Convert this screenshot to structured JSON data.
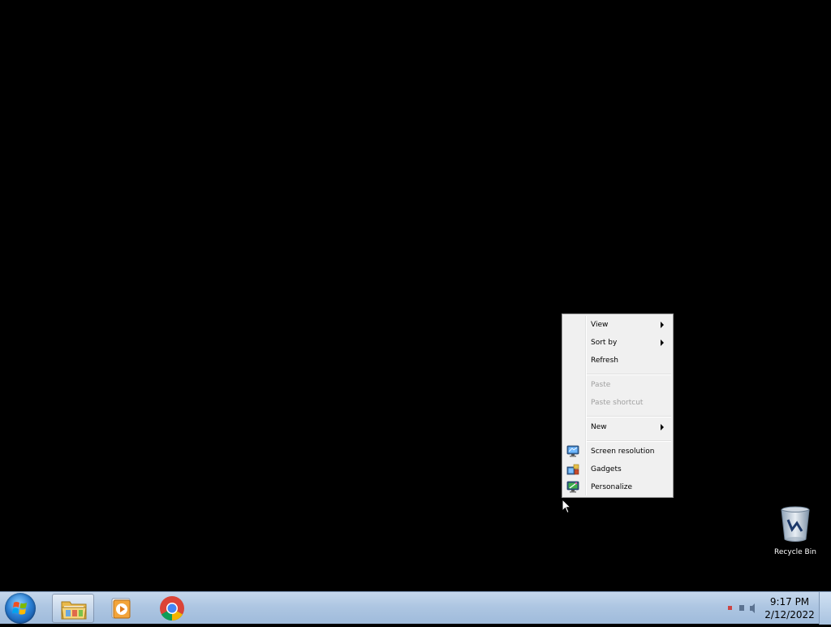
{
  "context_menu": {
    "items": [
      {
        "label": "View",
        "submenu": true,
        "disabled": false
      },
      {
        "label": "Sort by",
        "submenu": true,
        "disabled": false
      },
      {
        "label": "Refresh",
        "submenu": false,
        "disabled": false
      },
      {
        "label": "Paste",
        "submenu": false,
        "disabled": true
      },
      {
        "label": "Paste shortcut",
        "submenu": false,
        "disabled": true
      },
      {
        "label": "New",
        "submenu": true,
        "disabled": false
      },
      {
        "label": "Screen resolution",
        "icon": "screen-resolution-icon",
        "disabled": false
      },
      {
        "label": "Gadgets",
        "icon": "gadgets-icon",
        "disabled": false
      },
      {
        "label": "Personalize",
        "icon": "personalize-icon",
        "disabled": false
      }
    ]
  },
  "desktop": {
    "recycle_bin_label": "Recycle Bin"
  },
  "taskbar": {
    "pinned": [
      {
        "name": "windows-explorer",
        "icon": "folder-icon",
        "active": true
      },
      {
        "name": "windows-media-player",
        "icon": "media-player-icon",
        "active": false
      },
      {
        "name": "google-chrome",
        "icon": "chrome-icon",
        "active": false
      }
    ],
    "clock": {
      "time": "9:17 PM",
      "date": "2/12/2022"
    }
  },
  "colors": {
    "desktop_background": "#000000",
    "taskbar": "#aec6e2",
    "menu_background": "#f0f0f0",
    "disabled_text": "#a0a0a0"
  }
}
